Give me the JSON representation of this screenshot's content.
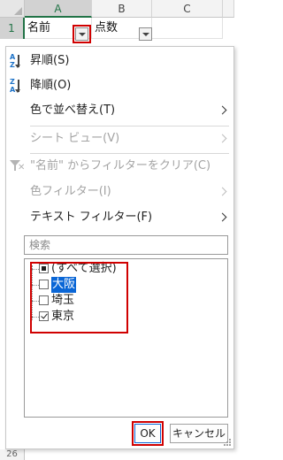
{
  "sheet": {
    "columns": [
      "A",
      "B",
      "C"
    ],
    "row_numbers": [
      "1"
    ],
    "bottom_row_label": "26",
    "cells": {
      "a1": "名前",
      "b1": "点数"
    }
  },
  "menu": {
    "sort_ascending": "昇順(S)",
    "sort_descending": "降順(O)",
    "sort_by_color": "色で並べ替え(T)",
    "sheet_view": "シート ビュー(V)",
    "clear_filter": "\"名前\" からフィルターをクリア(C)",
    "color_filter": "色フィルター(I)",
    "text_filter": "テキスト フィルター(F)"
  },
  "search": {
    "placeholder": "検索"
  },
  "filter_list": [
    {
      "label": "(すべて選択)",
      "state": "partial"
    },
    {
      "label": "大阪",
      "state": "unchecked",
      "selected": true
    },
    {
      "label": "埼玉",
      "state": "unchecked"
    },
    {
      "label": "東京",
      "state": "checked"
    }
  ],
  "buttons": {
    "ok": "OK",
    "cancel": "キャンセル"
  },
  "colors": {
    "highlight": "#d00000",
    "selection": "#0a66d6",
    "excel_green": "#217346"
  }
}
